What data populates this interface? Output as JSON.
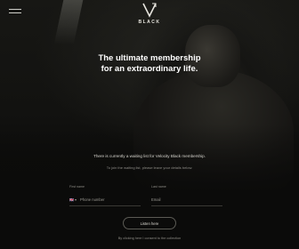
{
  "brand": {
    "logo_text": "BLACK"
  },
  "hero": {
    "headline_line1": "The ultimate membership",
    "headline_line2": "for an extraordinary life."
  },
  "waitlist": {
    "text": "There is currently a waiting list for Velocity Black membership.",
    "subtext": "To join the waiting list, please leave your details below."
  },
  "form": {
    "first_field": {
      "label": "First name",
      "placeholder": "Phone number",
      "flag": "🇬🇧"
    },
    "last_field": {
      "label": "Last name",
      "placeholder": "Email"
    },
    "submit_label": "Listen here"
  },
  "footer": {
    "recaptcha_note": "By clicking here I consent to the collection"
  },
  "colors": {
    "background": "#0b0b0a",
    "text": "#ffffff",
    "muted": "#8d8b85"
  }
}
